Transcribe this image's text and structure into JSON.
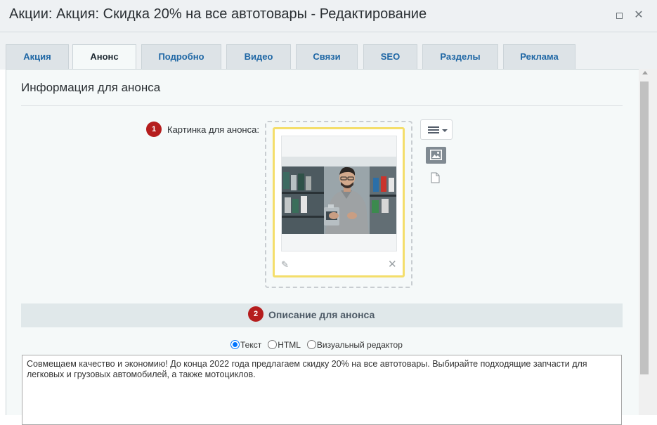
{
  "window": {
    "title": "Акции: Акция: Скидка 20% на все автотовары - Редактирование"
  },
  "tabs": [
    {
      "label": "Акция",
      "active": false
    },
    {
      "label": "Анонс",
      "active": true
    },
    {
      "label": "Подробно",
      "active": false
    },
    {
      "label": "Видео",
      "active": false
    },
    {
      "label": "Связи",
      "active": false
    },
    {
      "label": "SEO",
      "active": false
    },
    {
      "label": "Разделы",
      "active": false
    },
    {
      "label": "Реклама",
      "active": false
    }
  ],
  "section": {
    "title": "Информация для анонса"
  },
  "preview_image": {
    "badge": "1",
    "label": "Картинка для анонса:"
  },
  "description": {
    "badge": "2",
    "title": "Описание для анонса",
    "modes": [
      {
        "label": "Текст",
        "selected": true
      },
      {
        "label": "HTML",
        "selected": false
      },
      {
        "label": "Визуальный редактор",
        "selected": false
      }
    ],
    "text": "Совмещаем качество и экономию! До конца 2022 года предлагаем скидку 20% на все автотовары. Выбирайте подходящие запчасти для легковых и грузовых автомобилей, а также мотоциклов."
  },
  "colors": {
    "badge": "#b51d1d",
    "tab_link": "#1f67a5",
    "card_border": "#f4de6b"
  }
}
